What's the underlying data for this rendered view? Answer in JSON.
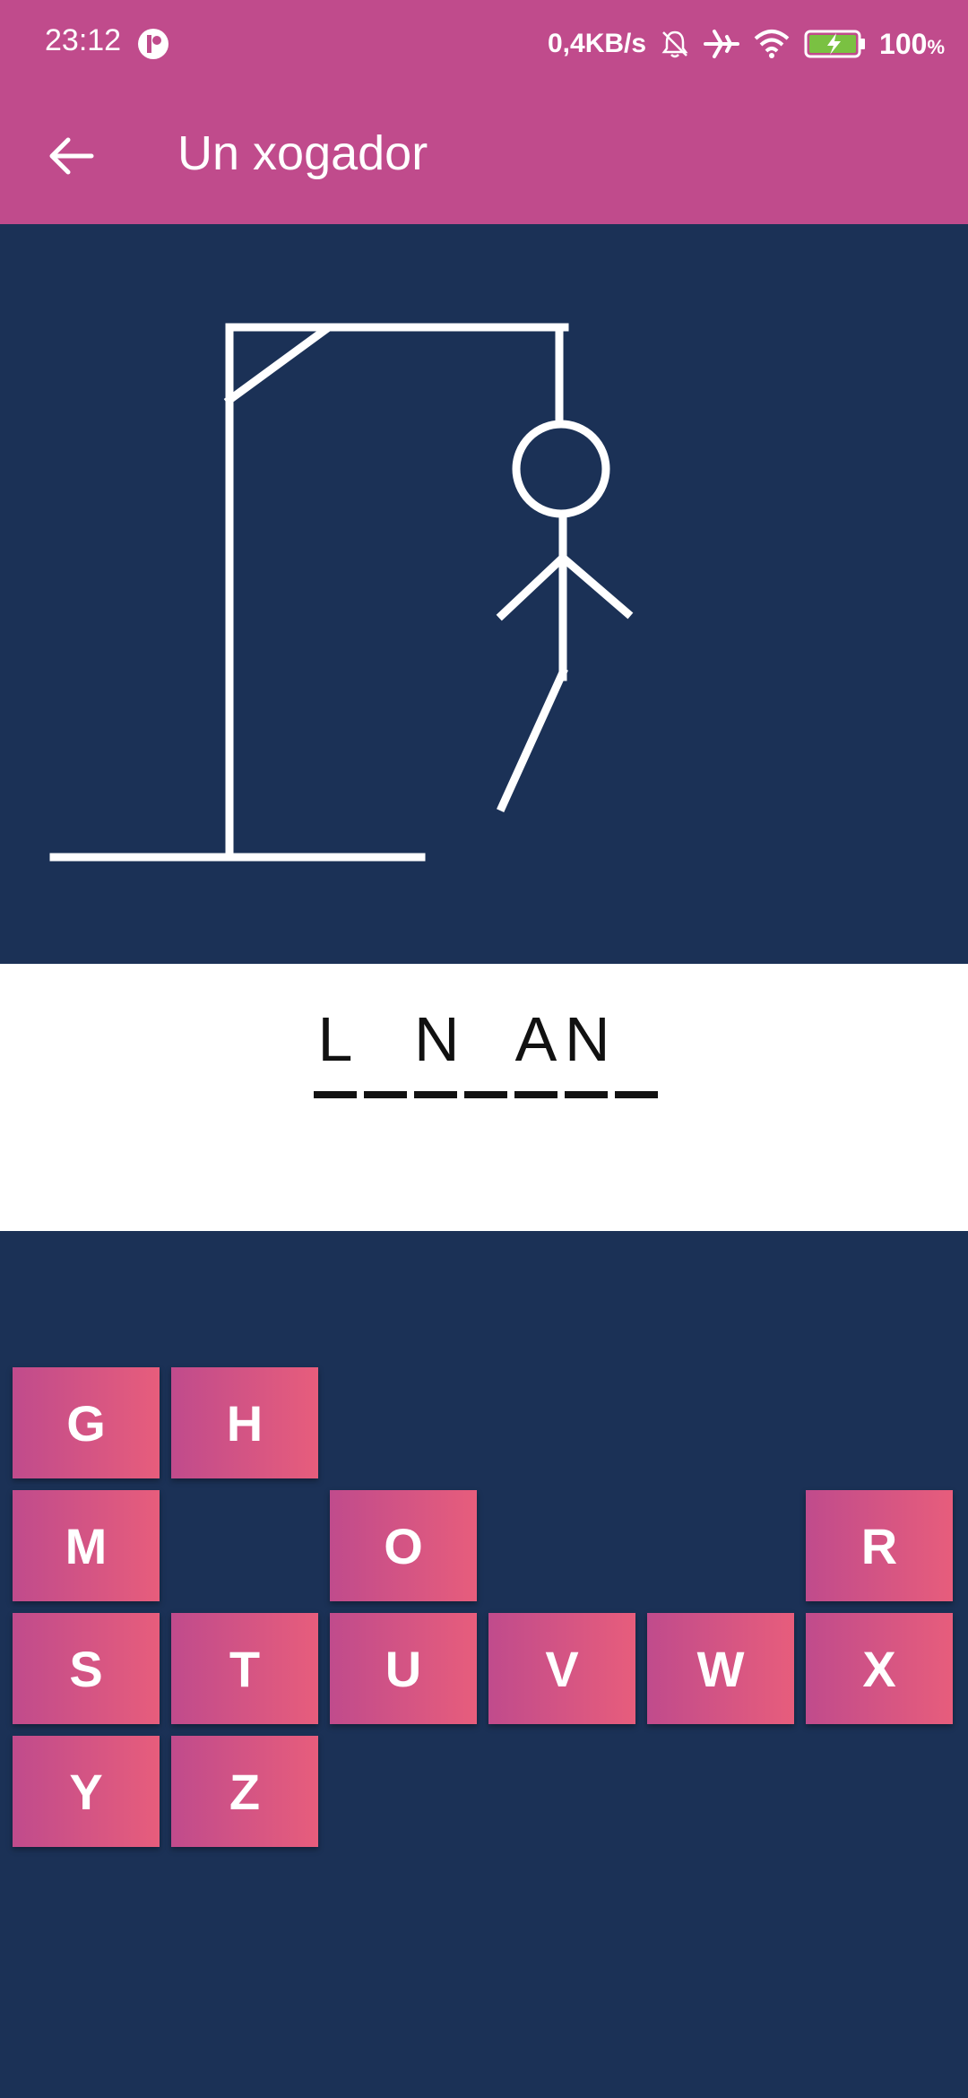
{
  "status_bar": {
    "time": "23:12",
    "net_speed": "0,4KB/s",
    "battery": "100",
    "battery_unit": "%"
  },
  "app_bar": {
    "title": "Un xogador",
    "back_icon": "arrow-left-icon"
  },
  "word": {
    "slots": [
      "L",
      "",
      "N",
      "",
      "A",
      "N",
      ""
    ]
  },
  "keyboard": {
    "rows": [
      [
        {
          "col": 0,
          "label": "G"
        },
        {
          "col": 1,
          "label": "H"
        }
      ],
      [
        {
          "col": 0,
          "label": "M"
        },
        {
          "col": 2,
          "label": "O"
        },
        {
          "col": 5,
          "label": "R"
        }
      ],
      [
        {
          "col": 0,
          "label": "S"
        },
        {
          "col": 1,
          "label": "T"
        },
        {
          "col": 2,
          "label": "U"
        },
        {
          "col": 3,
          "label": "V"
        },
        {
          "col": 4,
          "label": "W"
        },
        {
          "col": 5,
          "label": "X"
        }
      ],
      [
        {
          "col": 0,
          "label": "Y"
        },
        {
          "col": 1,
          "label": "Z"
        }
      ]
    ]
  },
  "colors": {
    "primary": "#c04b8c",
    "key_gradient_end": "#e75d7c",
    "background": "#1b3156",
    "word_panel": "#ffffff"
  }
}
